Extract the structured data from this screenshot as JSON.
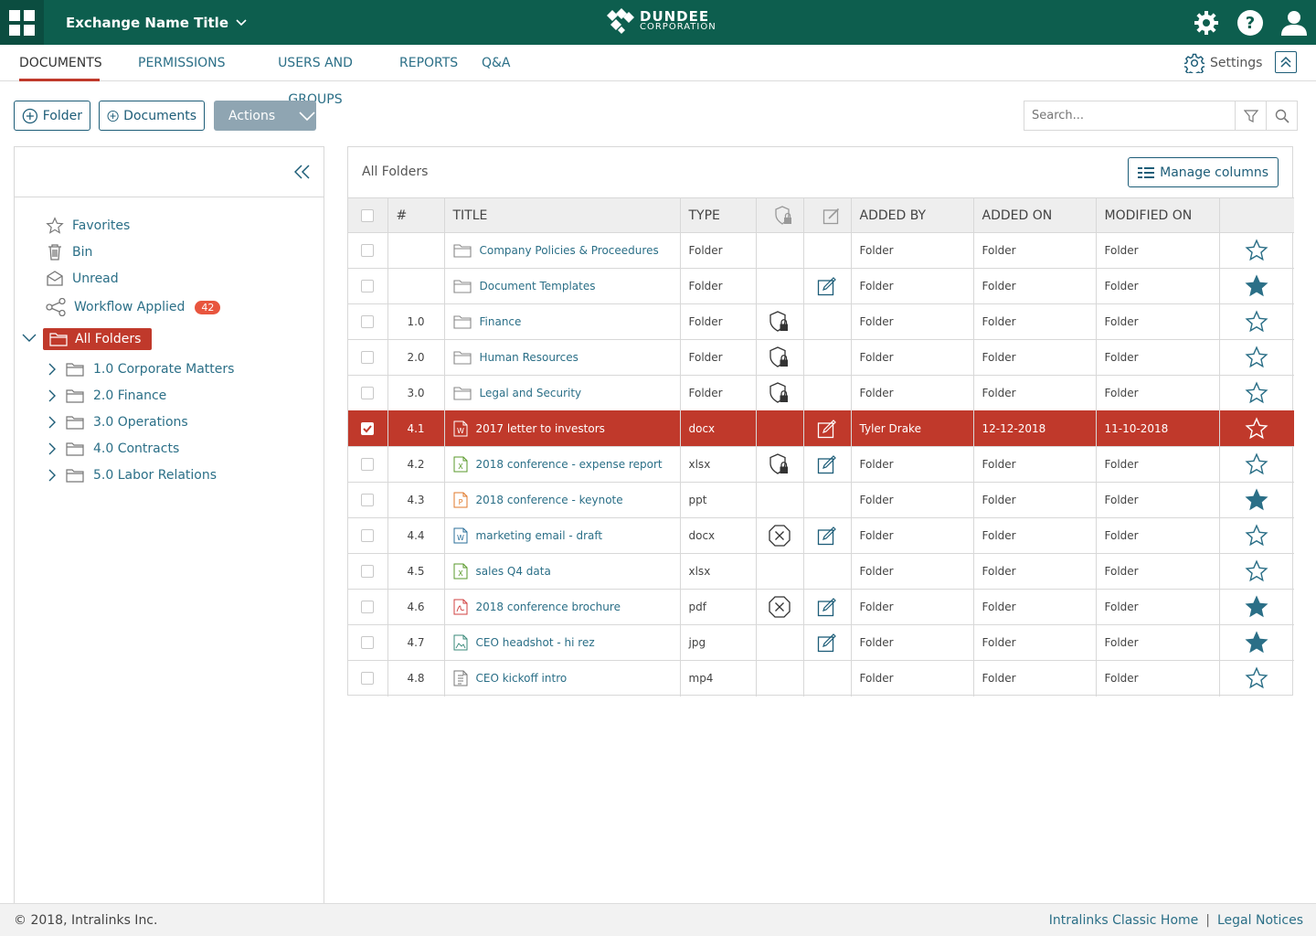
{
  "header": {
    "exchange_title": "Exchange Name Title",
    "brand_name": "DUNDEE",
    "brand_sub": "CORPORATION",
    "colors": {
      "topbar": "#0d5e4e",
      "accent": "#c0392b",
      "link": "#2b6f87"
    }
  },
  "tabs": {
    "documents": "DOCUMENTS",
    "permissions": "PERMISSIONS",
    "users_groups": "USERS AND GROUPS",
    "reports": "REPORTS",
    "qa": "Q&A",
    "settings": "Settings"
  },
  "toolbar": {
    "folder_label": "Folder",
    "documents_label": "Documents",
    "actions_label": "Actions",
    "search_placeholder": "Search..."
  },
  "sidebar": {
    "favorites": "Favorites",
    "bin": "Bin",
    "unread": "Unread",
    "workflow": "Workflow Applied",
    "workflow_count": "42",
    "all_folders": "All Folders",
    "folders": [
      {
        "label": "1.0 Corporate Matters"
      },
      {
        "label": "2.0 Finance"
      },
      {
        "label": "3.0 Operations"
      },
      {
        "label": "4.0 Contracts"
      },
      {
        "label": "5.0 Labor Relations"
      }
    ]
  },
  "main": {
    "breadcrumb": "All Folders",
    "manage_columns": "Manage columns",
    "columns": {
      "num": "#",
      "title": "TITLE",
      "type": "TYPE",
      "added_by": "ADDED BY",
      "added_on": "ADDED ON",
      "modified_on": "MODIFIED ON"
    },
    "rows": [
      {
        "num": "",
        "title": "Company Policies & Proceedures",
        "icon": "folder",
        "type": "Folder",
        "lock": "",
        "edit": false,
        "added_by": "Folder",
        "added_on": "Folder",
        "modified_on": "Folder",
        "star": false,
        "selected": false
      },
      {
        "num": "",
        "title": "Document Templates",
        "icon": "folder",
        "type": "Folder",
        "lock": "",
        "edit": true,
        "added_by": "Folder",
        "added_on": "Folder",
        "modified_on": "Folder",
        "star": true,
        "selected": false
      },
      {
        "num": "1.0",
        "title": "Finance",
        "icon": "folder",
        "type": "Folder",
        "lock": "lock",
        "edit": false,
        "added_by": "Folder",
        "added_on": "Folder",
        "modified_on": "Folder",
        "star": false,
        "selected": false
      },
      {
        "num": "2.0",
        "title": "Human Resources",
        "icon": "folder",
        "type": "Folder",
        "lock": "lock",
        "edit": false,
        "added_by": "Folder",
        "added_on": "Folder",
        "modified_on": "Folder",
        "star": false,
        "selected": false
      },
      {
        "num": "3.0",
        "title": "Legal and Security",
        "icon": "folder",
        "type": "Folder",
        "lock": "lock",
        "edit": false,
        "added_by": "Folder",
        "added_on": "Folder",
        "modified_on": "Folder",
        "star": false,
        "selected": false
      },
      {
        "num": "4.1",
        "title": "2017 letter to investors",
        "icon": "docx",
        "type": "docx",
        "lock": "",
        "edit": true,
        "added_by": "Tyler Drake",
        "added_on": "12-12-2018",
        "modified_on": "11-10-2018",
        "star": false,
        "selected": true
      },
      {
        "num": "4.2",
        "title": "2018 conference - expense report",
        "icon": "xlsx",
        "type": "xlsx",
        "lock": "lock",
        "edit": true,
        "added_by": "Folder",
        "added_on": "Folder",
        "modified_on": "Folder",
        "star": false,
        "selected": false
      },
      {
        "num": "4.3",
        "title": "2018 conference - keynote",
        "icon": "ppt",
        "type": "ppt",
        "lock": "",
        "edit": false,
        "added_by": "Folder",
        "added_on": "Folder",
        "modified_on": "Folder",
        "star": true,
        "selected": false
      },
      {
        "num": "4.4",
        "title": "marketing email - draft",
        "icon": "docx",
        "type": "docx",
        "lock": "x",
        "edit": true,
        "added_by": "Folder",
        "added_on": "Folder",
        "modified_on": "Folder",
        "star": false,
        "selected": false
      },
      {
        "num": "4.5",
        "title": "sales Q4 data",
        "icon": "xlsx",
        "type": "xlsx",
        "lock": "",
        "edit": false,
        "added_by": "Folder",
        "added_on": "Folder",
        "modified_on": "Folder",
        "star": false,
        "selected": false
      },
      {
        "num": "4.6",
        "title": "2018 conference brochure",
        "icon": "pdf",
        "type": "pdf",
        "lock": "x",
        "edit": true,
        "added_by": "Folder",
        "added_on": "Folder",
        "modified_on": "Folder",
        "star": true,
        "selected": false
      },
      {
        "num": "4.7",
        "title": "CEO headshot - hi rez",
        "icon": "jpg",
        "type": "jpg",
        "lock": "",
        "edit": true,
        "added_by": "Folder",
        "added_on": "Folder",
        "modified_on": "Folder",
        "star": true,
        "selected": false
      },
      {
        "num": "4.8",
        "title": "CEO kickoff intro",
        "icon": "mp4",
        "type": "mp4",
        "lock": "",
        "edit": false,
        "added_by": "Folder",
        "added_on": "Folder",
        "modified_on": "Folder",
        "star": false,
        "selected": false
      }
    ]
  },
  "footer": {
    "copyright": "© 2018, Intralinks Inc.",
    "classic_home": "Intralinks Classic Home",
    "separator": "|",
    "legal": "Legal Notices"
  }
}
